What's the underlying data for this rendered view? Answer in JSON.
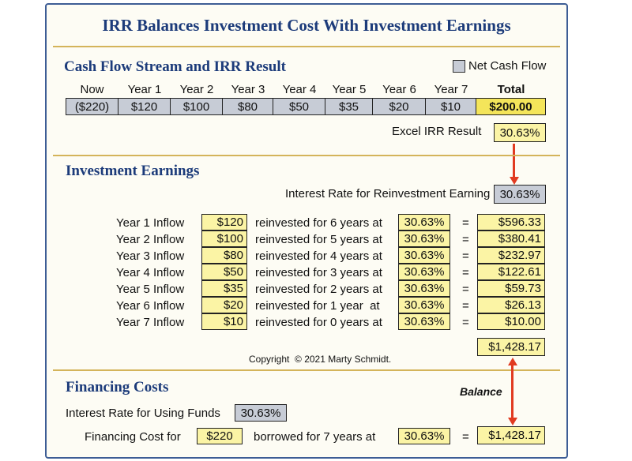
{
  "title": "IRR Balances Investment Cost With Investment Earnings",
  "cash_flow": {
    "heading": "Cash Flow Stream and IRR Result",
    "legend_label": "Net Cash Flow",
    "headers": [
      "Now",
      "Year 1",
      "Year 2",
      "Year 3",
      "Year 4",
      "Year 5",
      "Year 6",
      "Year 7",
      "Total"
    ],
    "values": [
      "($220)",
      "$120",
      "$100",
      "$80",
      "$50",
      "$35",
      "$20",
      "$10",
      "$200.00"
    ],
    "irr_label": "Excel IRR Result",
    "irr_value": "30.63%"
  },
  "earnings": {
    "heading": "Investment Earnings",
    "rate_label": "Interest Rate for Reinvestment Earning",
    "rate_value": "30.63%",
    "rows": [
      {
        "label": "Year 1 Inflow",
        "amount": "$120",
        "text": "reinvested for 6 years at",
        "rate": "30.63%",
        "eq": "=",
        "result": "$596.33"
      },
      {
        "label": "Year 2 Inflow",
        "amount": "$100",
        "text": "reinvested for 5 years at",
        "rate": "30.63%",
        "eq": "=",
        "result": "$380.41"
      },
      {
        "label": "Year 3 Inflow",
        "amount": "$80",
        "text": "reinvested for 4 years at",
        "rate": "30.63%",
        "eq": "=",
        "result": "$232.97"
      },
      {
        "label": "Year 4 Inflow",
        "amount": "$50",
        "text": "reinvested for 3 years at",
        "rate": "30.63%",
        "eq": "=",
        "result": "$122.61"
      },
      {
        "label": "Year 5 Inflow",
        "amount": "$35",
        "text": "reinvested for 2 years at",
        "rate": "30.63%",
        "eq": "=",
        "result": "$59.73"
      },
      {
        "label": "Year 6 Inflow",
        "amount": "$20",
        "text": "reinvested for 1 year  at",
        "rate": "30.63%",
        "eq": "=",
        "result": "$26.13"
      },
      {
        "label": "Year 7 Inflow",
        "amount": "$10",
        "text": "reinvested for 0 years at",
        "rate": "30.63%",
        "eq": "=",
        "result": "$10.00"
      }
    ],
    "total": "$1,428.17",
    "copyright": "Copyright  © 2021 Marty Schmidt."
  },
  "financing": {
    "heading": "Financing Costs",
    "balance_label": "Balance",
    "rate_label": "Interest Rate for Using Funds",
    "rate_value": "30.63%",
    "cost_label": "Financing Cost for",
    "amount": "$220",
    "text": "borrowed for 7 years at",
    "rate": "30.63%",
    "eq": "=",
    "result": "$1,428.17"
  },
  "colors": {
    "title": "#1c3b7a",
    "rule": "#d4b45a",
    "yellow_box": "#fbf4a5",
    "gray_box": "#c7ccd6",
    "total_box": "#f4e55a",
    "arrow": "#e13b21"
  }
}
